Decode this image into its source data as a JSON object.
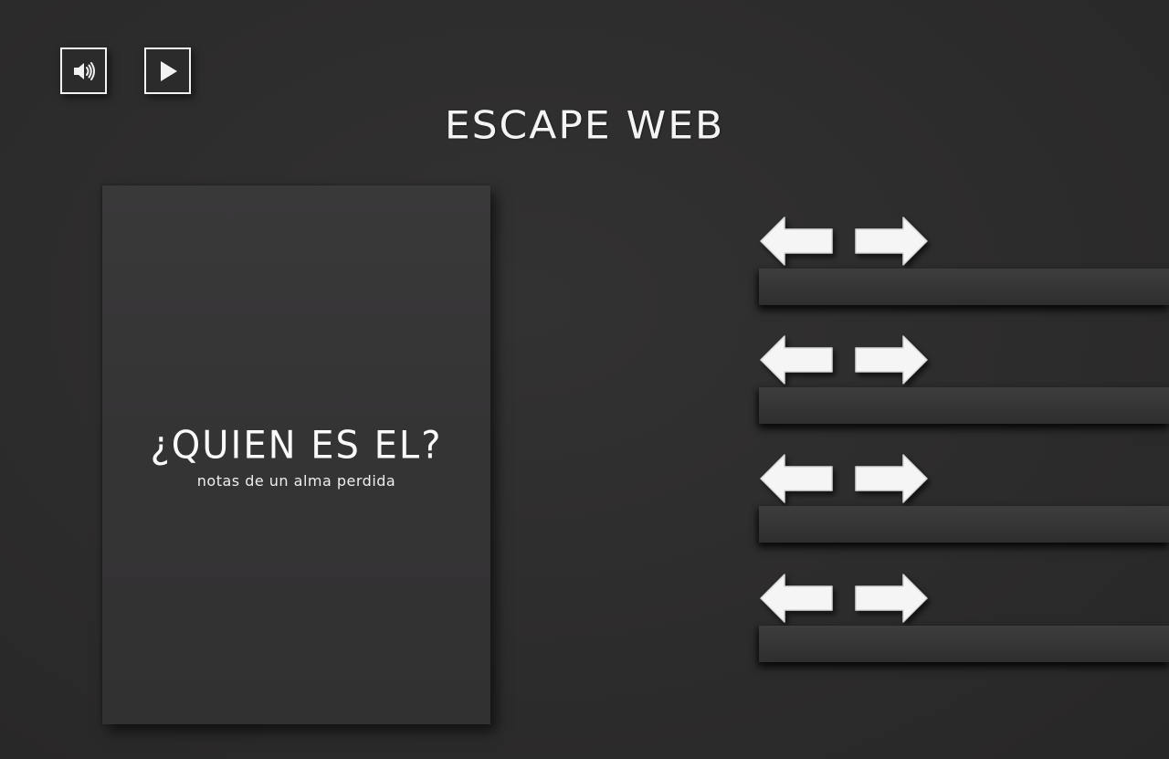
{
  "header": {
    "title": "ESCAPE WEB",
    "sound_icon": "speaker-volume-icon",
    "play_icon": "play-icon"
  },
  "book": {
    "title": "¿QUIEN ES EL?",
    "subtitle": "notas de un alma perdida"
  },
  "shelves": [
    {
      "left_icon": "arrow-left-icon",
      "right_icon": "arrow-right-icon"
    },
    {
      "left_icon": "arrow-left-icon",
      "right_icon": "arrow-right-icon"
    },
    {
      "left_icon": "arrow-left-icon",
      "right_icon": "arrow-right-icon"
    },
    {
      "left_icon": "arrow-left-icon",
      "right_icon": "arrow-right-icon"
    }
  ],
  "colors": {
    "background": "#2d2c2c",
    "book": "#363536",
    "text": "#ffffff",
    "arrow": "#f5f5f5"
  }
}
